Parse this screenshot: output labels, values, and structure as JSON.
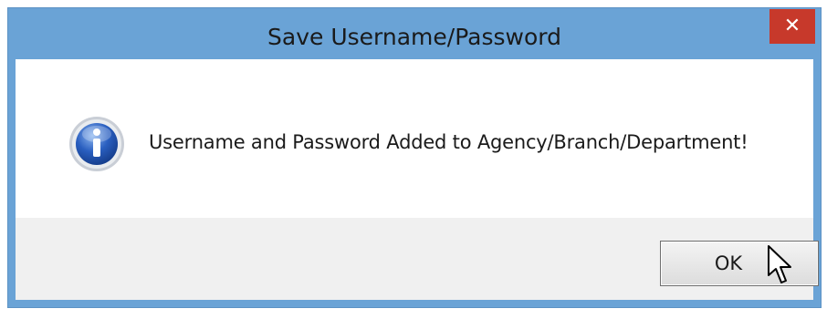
{
  "dialog": {
    "title": "Save Username/Password",
    "close_glyph": "✕",
    "message": "Username and Password Added to Agency/Branch/Department!",
    "icon": "information-icon",
    "ok_label": "OK"
  },
  "colors": {
    "titlebar": "#6aa3d6",
    "close_button": "#c7392b",
    "content_bg": "#ffffff",
    "footer_bg": "#f0f0f0"
  }
}
